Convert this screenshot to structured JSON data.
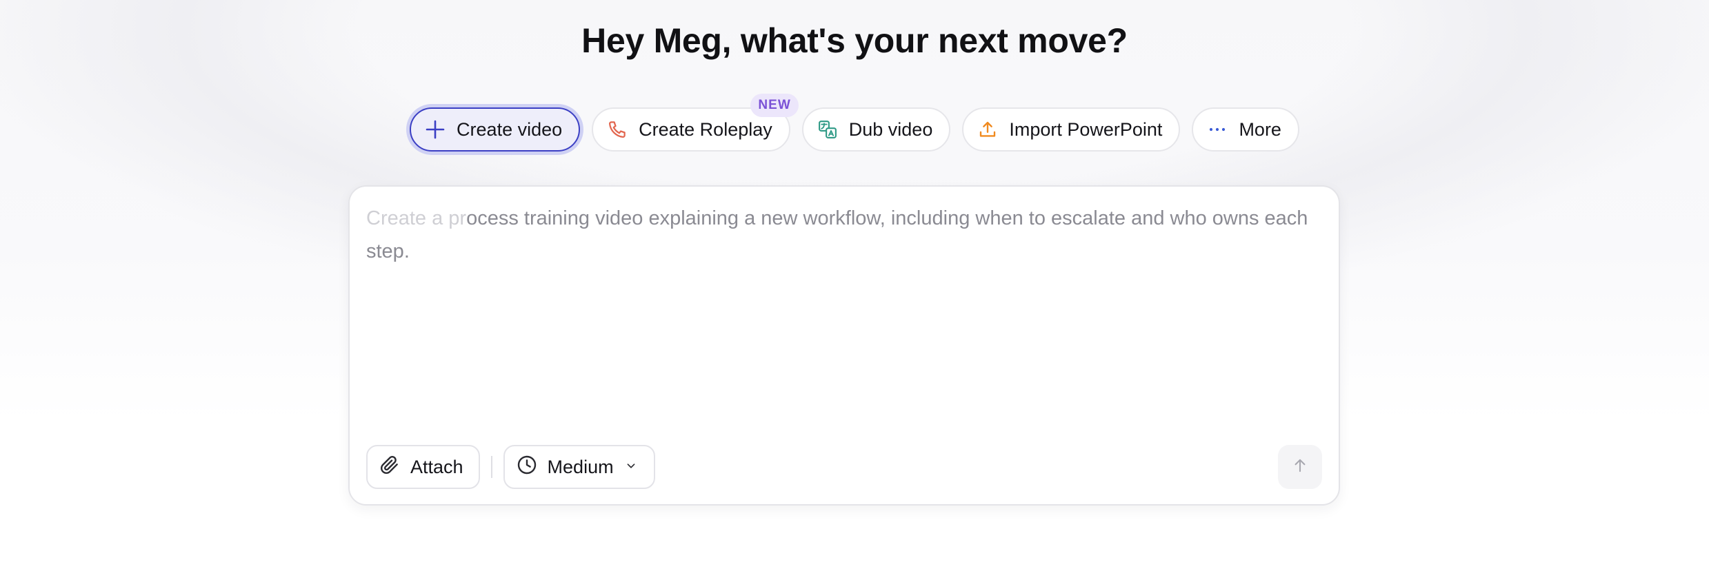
{
  "headline": "Hey Meg, what's your next move?",
  "chips": [
    {
      "label": "Create video",
      "icon": "plus-icon",
      "active": true
    },
    {
      "label": "Create Roleplay",
      "icon": "phone-icon",
      "badge": "NEW"
    },
    {
      "label": "Dub video",
      "icon": "translate-icon"
    },
    {
      "label": "Import PowerPoint",
      "icon": "upload-icon"
    },
    {
      "label": "More",
      "icon": "more-dots-icon"
    }
  ],
  "composer": {
    "placeholder_faded": "Create a pr",
    "placeholder_main": "ocess training video explaining a new workflow, including when to escalate and who owns each step.",
    "attach_label": "Attach",
    "length_label": "Medium"
  },
  "colors": {
    "accent": "#3b3fc4",
    "phone_icon": "#e2664f",
    "translate_icon": "#2f9a86",
    "upload_icon": "#f08a1f",
    "more_icon": "#3b5bd6",
    "badge_text": "#7b52d6"
  }
}
